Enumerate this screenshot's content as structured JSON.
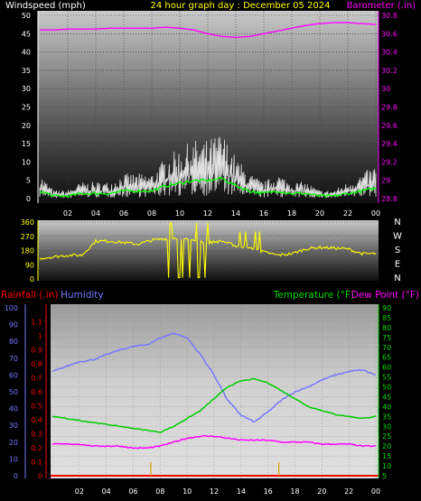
{
  "header": {
    "left_label": "Windspeed (mph)",
    "center_label": "24 hour graph day : December 05 2024",
    "right_label": "Barometer (.in)"
  },
  "x_ticks": [
    "02",
    "04",
    "06",
    "08",
    "10",
    "12",
    "14",
    "16",
    "18",
    "20",
    "22",
    "00"
  ],
  "panel_bottom": {
    "rain_label": "Rainfall (.in)",
    "humidity_label": "Humidity",
    "temp_label": "Temperature (°F)",
    "dew_label": "Dew Point (°F)"
  },
  "compass": [
    "N",
    "W",
    "S",
    "E",
    "N"
  ],
  "colors": {
    "wind": "#ffffff",
    "wind_avg": "#00ff00",
    "barometer": "#ff00ff",
    "direction": "#ffff00",
    "humidity": "#7777ff",
    "temperature": "#00cc00",
    "dew_point": "#ff00ff",
    "rain": "#ff0000"
  },
  "chart_data": [
    {
      "type": "line",
      "ylabel": "Windspeed (mph)",
      "y2label": "Barometer (.in)",
      "ylim": [
        0,
        50
      ],
      "y2lim": [
        28.8,
        30.8
      ],
      "y_ticks": [
        "0",
        "5",
        "10",
        "15",
        "20",
        "25",
        "30",
        "35",
        "40",
        "45",
        "50"
      ],
      "y2_ticks": [
        "28.8",
        "29",
        "29.2",
        "29.4",
        "29.6",
        "29.8",
        "30",
        "30.2",
        "30.4",
        "30.6",
        "30.8"
      ],
      "x_hours": [
        0,
        1,
        2,
        3,
        4,
        5,
        6,
        7,
        8,
        9,
        10,
        11,
        12,
        13,
        14,
        15,
        16,
        17,
        18,
        19,
        20,
        21,
        22,
        23,
        24
      ],
      "series": [
        {
          "name": "Windspeed (mph)",
          "values": [
            3,
            1,
            1,
            2,
            2,
            2,
            3,
            3,
            3,
            5,
            6,
            7,
            7,
            8,
            5,
            3,
            2,
            3,
            2,
            2,
            1,
            1,
            2,
            3,
            4
          ]
        },
        {
          "name": "Barometer (.in)",
          "values": [
            30.64,
            30.64,
            30.65,
            30.65,
            30.65,
            30.66,
            30.66,
            30.66,
            30.66,
            30.67,
            30.66,
            30.64,
            30.6,
            30.57,
            30.56,
            30.57,
            30.6,
            30.63,
            30.66,
            30.69,
            30.71,
            30.72,
            30.72,
            30.71,
            30.7
          ]
        }
      ]
    },
    {
      "type": "line",
      "ylabel": "Wind direction",
      "ylim": [
        0,
        360
      ],
      "y_ticks": [
        "0",
        "90",
        "180",
        "270",
        "360"
      ],
      "x_hours": [
        0,
        1,
        2,
        3,
        4,
        5,
        6,
        7,
        8,
        9,
        10,
        11,
        12,
        13,
        14,
        15,
        16,
        17,
        18,
        19,
        20,
        21,
        22,
        23,
        24
      ],
      "series": [
        {
          "name": "Wind direction",
          "values": [
            130,
            140,
            150,
            150,
            240,
            240,
            230,
            220,
            245,
            255,
            250,
            245,
            230,
            240,
            210,
            200,
            170,
            150,
            160,
            190,
            200,
            195,
            190,
            160,
            160
          ]
        }
      ]
    },
    {
      "type": "line",
      "x_hours": [
        0,
        1,
        2,
        3,
        4,
        5,
        6,
        7,
        8,
        9,
        10,
        11,
        12,
        13,
        14,
        15,
        16,
        17,
        18,
        19,
        20,
        21,
        22,
        23,
        24
      ],
      "series": [
        {
          "name": "Humidity",
          "axis": "left",
          "ylim": [
            0,
            100
          ],
          "y_ticks": [
            "0",
            "10",
            "20",
            "30",
            "40",
            "50",
            "60",
            "70",
            "80",
            "90",
            "100"
          ],
          "values": [
            62,
            65,
            68,
            69,
            72,
            75,
            77,
            78,
            82,
            85,
            82,
            72,
            60,
            45,
            36,
            32,
            38,
            45,
            50,
            53,
            57,
            60,
            62,
            63,
            60
          ]
        },
        {
          "name": "Rainfall (.in)",
          "axis": "left-inner",
          "ylim": [
            0,
            1.2
          ],
          "y_ticks": [
            "0",
            "0.1",
            "0.2",
            "0.3",
            "0.4",
            "0.5",
            "0.6",
            "0.7",
            "0.8",
            "0.9",
            "1",
            "1.1"
          ],
          "values": [
            0,
            0,
            0,
            0,
            0,
            0,
            0,
            0,
            0,
            0,
            0,
            0,
            0,
            0,
            0,
            0,
            0,
            0,
            0,
            0,
            0,
            0,
            0,
            0,
            0
          ]
        },
        {
          "name": "Temperature (°F)",
          "axis": "right",
          "ylim": [
            5,
            90
          ],
          "y_ticks": [
            "5",
            "10",
            "15",
            "20",
            "25",
            "30",
            "35",
            "40",
            "45",
            "50",
            "55",
            "60",
            "65",
            "70",
            "75",
            "80",
            "85",
            "90"
          ],
          "values": [
            35,
            34,
            33,
            32,
            31,
            30,
            29,
            28,
            27,
            30,
            34,
            38,
            44,
            50,
            53,
            54,
            52,
            48,
            44,
            40,
            38,
            36,
            35,
            34,
            35
          ]
        },
        {
          "name": "Dew Point (°F)",
          "axis": "right",
          "ylim": [
            5,
            90
          ],
          "values": [
            21,
            21,
            21,
            20,
            20,
            20,
            19,
            19,
            20,
            22,
            24,
            25,
            25,
            24,
            23,
            23,
            23,
            22,
            22,
            22,
            21,
            21,
            21,
            20,
            20
          ]
        }
      ]
    }
  ]
}
